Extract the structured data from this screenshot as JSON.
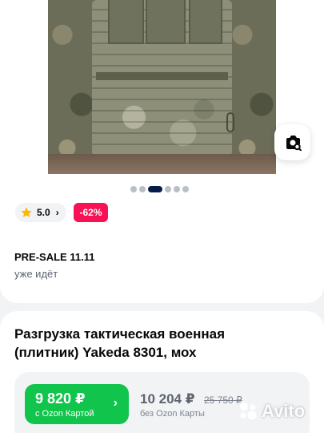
{
  "gallery": {
    "slides_count": 6,
    "active_slide": 3,
    "visual_search_icon": "camera-search-icon"
  },
  "rating": {
    "value": "5.0",
    "icon": "star-icon"
  },
  "discount": {
    "label": "-62%"
  },
  "presale": {
    "title": "PRE-SALE 11.11",
    "subtitle": "уже идёт"
  },
  "product": {
    "title": "Разгрузка тактическая военная (плитник) Yakeda 8301, мох"
  },
  "pricing": {
    "ozon_price": "9 820 ₽",
    "ozon_caption": "с Ozon Картой",
    "regular_price": "10 204 ₽",
    "old_price": "25 750 ₽",
    "regular_caption": "без Ozon Карты"
  },
  "watermark": {
    "text": "Avito"
  },
  "colors": {
    "accent_green": "#10c44c",
    "discount_red": "#f91155",
    "dot_active": "#071d49",
    "star": "#ffb800"
  }
}
